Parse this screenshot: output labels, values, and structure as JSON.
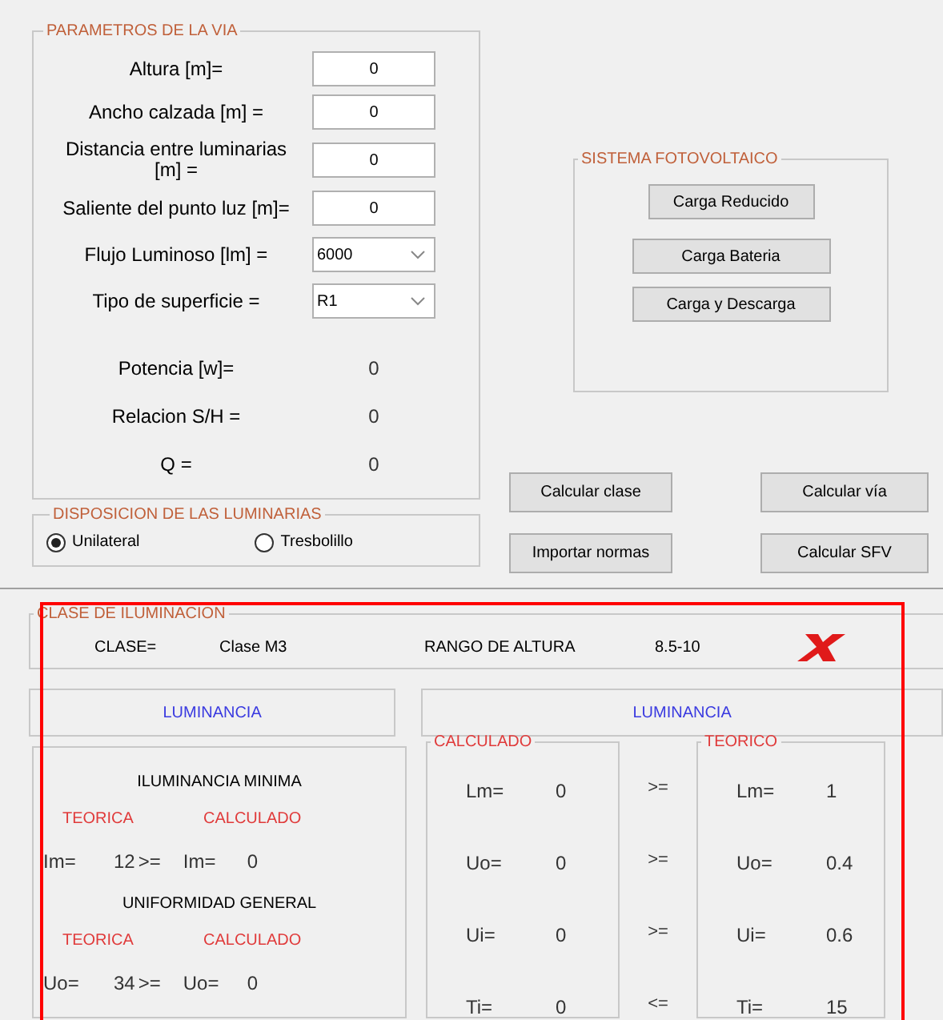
{
  "via_panel": {
    "title": "PARAMETROS DE LA VIA",
    "fields": [
      {
        "kind": "input",
        "label": "Altura [m]=",
        "value": "0"
      },
      {
        "kind": "input",
        "label": "Ancho calzada [m] =",
        "value": "0"
      },
      {
        "kind": "input",
        "label": "Distancia entre luminarias [m]  =",
        "value": "0"
      },
      {
        "kind": "input",
        "label": "Saliente del punto luz [m]=",
        "value": "0"
      },
      {
        "kind": "select",
        "label": "Flujo Luminoso [lm] =",
        "value": "6000"
      },
      {
        "kind": "select",
        "label": "Tipo de superficie =",
        "value": "R1"
      },
      {
        "kind": "output",
        "label": "Potencia [w]=",
        "value": "0"
      },
      {
        "kind": "output",
        "label": "Relacion S/H =",
        "value": "0"
      },
      {
        "kind": "output",
        "label": "Q =",
        "value": "0"
      }
    ]
  },
  "disposicion_panel": {
    "title": "DISPOSICION DE LAS LUMINARIAS",
    "options": [
      {
        "label": "Unilateral",
        "selected": true
      },
      {
        "label": "Tresbolillo",
        "selected": false
      }
    ]
  },
  "fotovoltaico_panel": {
    "title": "SISTEMA FOTOVOLTAICO",
    "buttons": [
      "Carga Reducido",
      "Carga Bateria",
      "Carga y Descarga"
    ]
  },
  "action_buttons": [
    "Calcular clase",
    "Calcular vía",
    "Importar normas",
    "Calcular SFV"
  ],
  "clase_panel": {
    "title": "CLASE DE ILUMINACION",
    "clase_label": "CLASE=",
    "clase_value": "Clase M3",
    "rango_label": "RANGO DE ALTURA",
    "rango_value": "8.5-10"
  },
  "luminancia_headers": [
    "LUMINANCIA",
    "LUMINANCIA"
  ],
  "iluminancia_sections": [
    {
      "title": "ILUMINANCIA MINIMA",
      "teorica": "TEORICA",
      "calculado": "CALCULADO",
      "label_teorica": "Im=",
      "value_teorica": "12",
      "comparator": ">=",
      "label_calculado": "Im=",
      "value_calculado": "0"
    },
    {
      "title": "UNIFORMIDAD GENERAL",
      "teorica": "TEORICA",
      "calculado": "CALCULADO",
      "label_teorica": "Uo=",
      "value_teorica": "34",
      "comparator": ">=",
      "label_calculado": "Uo=",
      "value_calculado": "0"
    }
  ],
  "calculado_panel": {
    "title": "CALCULADO",
    "rows": [
      {
        "label": "Lm=",
        "value": "0"
      },
      {
        "label": "Uo=",
        "value": "0"
      },
      {
        "label": "Ui=",
        "value": "0"
      },
      {
        "label": "Ti=",
        "value": "0"
      }
    ]
  },
  "comparators": [
    ">=",
    ">=",
    ">=",
    "<="
  ],
  "teorico_panel": {
    "title": "TEORICO",
    "rows": [
      {
        "label": "Lm=",
        "value": "1"
      },
      {
        "label": "Uo=",
        "value": "0.4"
      },
      {
        "label": "Ui=",
        "value": "0.6"
      },
      {
        "label": "Ti=",
        "value": "15"
      }
    ]
  }
}
